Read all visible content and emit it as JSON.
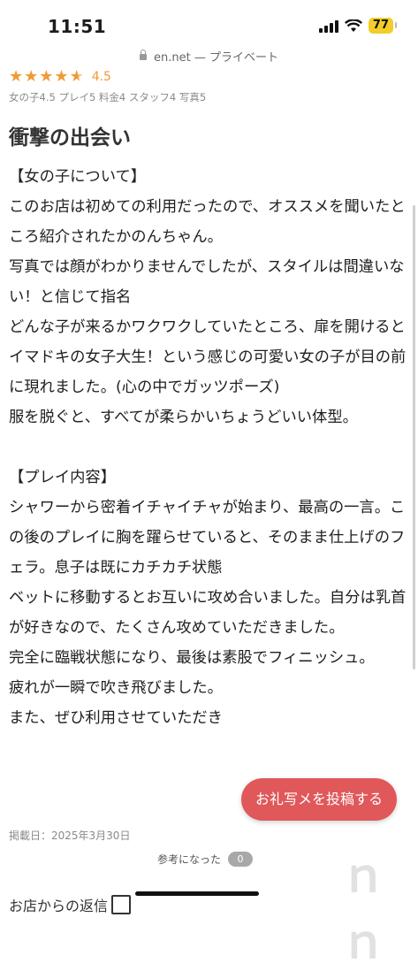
{
  "status_bar": {
    "time": "11:51",
    "battery": "77"
  },
  "url_bar": {
    "domain": "en.net",
    "separator": "—",
    "mode": "プライベート"
  },
  "review": {
    "stars": 4.5,
    "score": "4.5",
    "sub_scores": "女の子4.5 プレイ5 料金4 スタッフ4 写真5",
    "title": "衝撃の出会い",
    "paragraphs": [
      "【女の子について】",
      "このお店は初めての利用だったので、オススメを聞いたところ紹介されたかのんちゃん。",
      "写真では顔がわかりませんでしたが、スタイルは間違いない！と信じて指名",
      "どんな子が来るかワクワクしていたところ、扉を開けるとイマドキの女子大生！という感じの可愛い女の子が目の前に現れました。(心の中でガッツポーズ)",
      "服を脱ぐと、すべてが柔らかいちょうどいい体型。",
      " ",
      "【プレイ内容】",
      "シャワーから密着イチャイチャが始まり、最高の一言。この後のプレイに胸を躍らせていると、そのまま仕上げのフェラ。息子は既にカチカチ状態",
      "ベットに移動するとお互いに攻め合いました。自分は乳首が好きなので、たくさん攻めていただきました。",
      "完全に臨戦状態になり、最後は素股でフィニッシュ。",
      "疲れが一瞬で吹き飛びました。",
      "また、ぜひ利用させていただき"
    ],
    "date": "掲載日：2025年3月30日",
    "helpful_label": "参考になった",
    "helpful_count": "0",
    "reply_label": "お店からの返信"
  },
  "cta_button": {
    "label": "お礼写メを投稿する"
  },
  "watermark": "nn",
  "colors": {
    "star": "#f19a36",
    "cta": "#e0585a",
    "battery": "#f4cd2a"
  }
}
